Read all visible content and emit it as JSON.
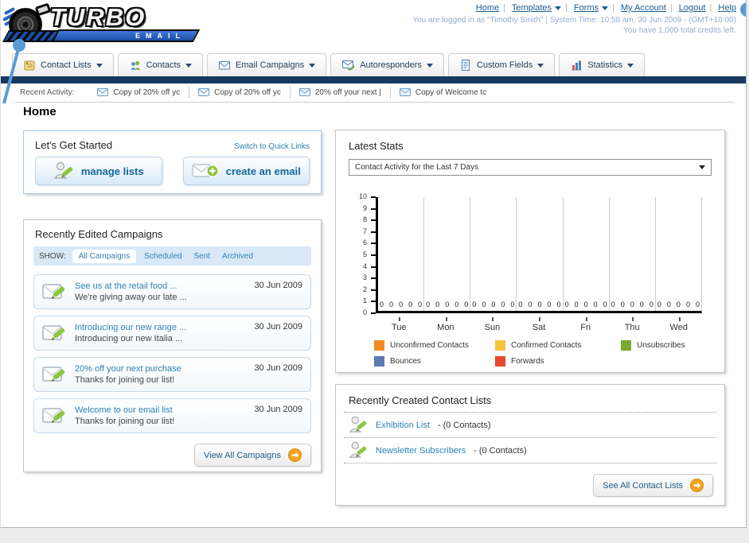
{
  "header": {
    "logo_line1": "TURBO",
    "logo_line2": "EMAIL",
    "nav": [
      {
        "label": "Home"
      },
      {
        "label": "Templates"
      },
      {
        "label": "Forms"
      },
      {
        "label": "My Account"
      },
      {
        "label": "Logout"
      },
      {
        "label": "Help"
      }
    ],
    "login_info": "You are logged in as \"Timothy Smith\" | System Time: 10:58 am, 30 Jun 2009 - (GMT+10:00)",
    "credits_info": "You have 1,000 total credits left."
  },
  "tabs": [
    {
      "label": "Contact Lists"
    },
    {
      "label": "Contacts"
    },
    {
      "label": "Email Campaigns"
    },
    {
      "label": "Autoresponders"
    },
    {
      "label": "Custom Fields"
    },
    {
      "label": "Statistics"
    }
  ],
  "activity": {
    "label": "Recent Activity:",
    "items": [
      {
        "text": "Copy of 20% off yc"
      },
      {
        "text": "Copy of 20% off yc"
      },
      {
        "text": "20% off your next |"
      },
      {
        "text": "Copy of Welcome tc"
      }
    ]
  },
  "page_title": "Home",
  "get_started": {
    "title": "Let's Get Started",
    "switch_link": "Switch to Quick Links",
    "manage_lists_label": "manage lists",
    "create_email_label": "create an email"
  },
  "campaigns": {
    "title": "Recently Edited Campaigns",
    "show_label": "SHOW:",
    "filters": [
      {
        "label": "All Campaigns"
      },
      {
        "label": "Scheduled"
      },
      {
        "label": "Sent"
      },
      {
        "label": "Archived"
      }
    ],
    "items": [
      {
        "title": "See us at the retail food ...",
        "subtitle": "We're giving away our late ...",
        "date": "30 Jun 2009"
      },
      {
        "title": "Introducing our new range ...",
        "subtitle": "Introducing our new Italia ...",
        "date": "30 Jun 2009"
      },
      {
        "title": "20% off your next purchase",
        "subtitle": "Thanks for joining our list!",
        "date": "30 Jun 2009"
      },
      {
        "title": "Welcome to our email list",
        "subtitle": "Thanks for joining our list!",
        "date": "30 Jun 2009"
      }
    ],
    "view_all_label": "View All Campaigns"
  },
  "stats": {
    "title": "Latest Stats",
    "dropdown_value": "Contact Activity for the Last 7 Days"
  },
  "chart_data": {
    "type": "bar",
    "title": "Contact Activity for the Last 7 Days",
    "categories": [
      "Tue",
      "Mon",
      "Sun",
      "Sat",
      "Fri",
      "Thu",
      "Wed"
    ],
    "series": [
      {
        "name": "Unconfirmed Contacts",
        "color": "#F08C21",
        "values": [
          0,
          0,
          0,
          0,
          0,
          0,
          0
        ]
      },
      {
        "name": "Confirmed Contacts",
        "color": "#F5C53C",
        "values": [
          0,
          0,
          0,
          0,
          0,
          0,
          0
        ]
      },
      {
        "name": "Unsubscribes",
        "color": "#7BA82E",
        "values": [
          0,
          0,
          0,
          0,
          0,
          0,
          0
        ]
      },
      {
        "name": "Bounces",
        "color": "#5B7AAE",
        "values": [
          0,
          0,
          0,
          0,
          0,
          0,
          0
        ]
      },
      {
        "name": "Forwards",
        "color": "#E8492E",
        "values": [
          0,
          0,
          0,
          0,
          0,
          0,
          0
        ]
      }
    ],
    "ylim": [
      0,
      10
    ],
    "yticks": [
      0,
      1,
      2,
      3,
      4,
      5,
      6,
      7,
      8,
      9,
      10
    ],
    "grid": true,
    "legend_position": "bottom",
    "xlabel": "",
    "ylabel": ""
  },
  "contact_lists": {
    "title": "Recently Created Contact Lists",
    "items": [
      {
        "name": "Exhibition List",
        "count": "- (0 Contacts)"
      },
      {
        "name": "Newsletter Subscribers",
        "count": "- (0 Contacts)"
      }
    ],
    "see_all_label": "See All Contact Lists"
  },
  "colors": {
    "accent_blue": "#2d83b5",
    "navy_bar": "#163a5f",
    "annotation_blue": "#5b9bd5",
    "button_orange": "#f6a21d"
  }
}
